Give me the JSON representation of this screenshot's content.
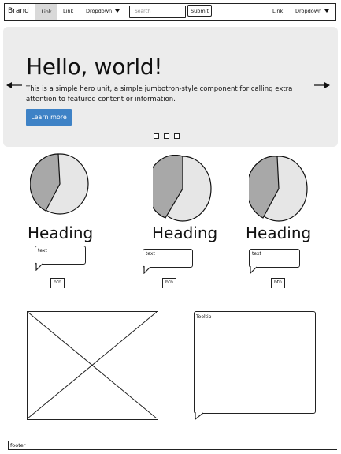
{
  "navbar": {
    "brand": "Brand",
    "links_left": [
      "Link",
      "Link"
    ],
    "dropdown_left": "Dropdown",
    "search_placeholder": "Search",
    "submit_label": "Submit",
    "link_right": "Link",
    "dropdown_right": "Dropdown"
  },
  "hero": {
    "title": "Hello, world!",
    "text": "This is a simple hero unit, a simple jumbotron-style component for calling extra attention to featured content or information.",
    "button_label": "Learn more",
    "carousel_dots": 3
  },
  "columns": [
    {
      "heading": "Heading",
      "text": "text",
      "button_label": "btn"
    },
    {
      "heading": "Heading",
      "text": "text",
      "button_label": "btn"
    },
    {
      "heading": "Heading",
      "text": "text",
      "button_label": "btn"
    }
  ],
  "tooltip": {
    "label": "Tooltip"
  },
  "footer": {
    "label": "footer"
  },
  "colors": {
    "accent": "#3e82c6",
    "hero_bg": "#ececec",
    "pie_dark": "#a8a8a8",
    "pie_light": "#e6e6e6"
  }
}
